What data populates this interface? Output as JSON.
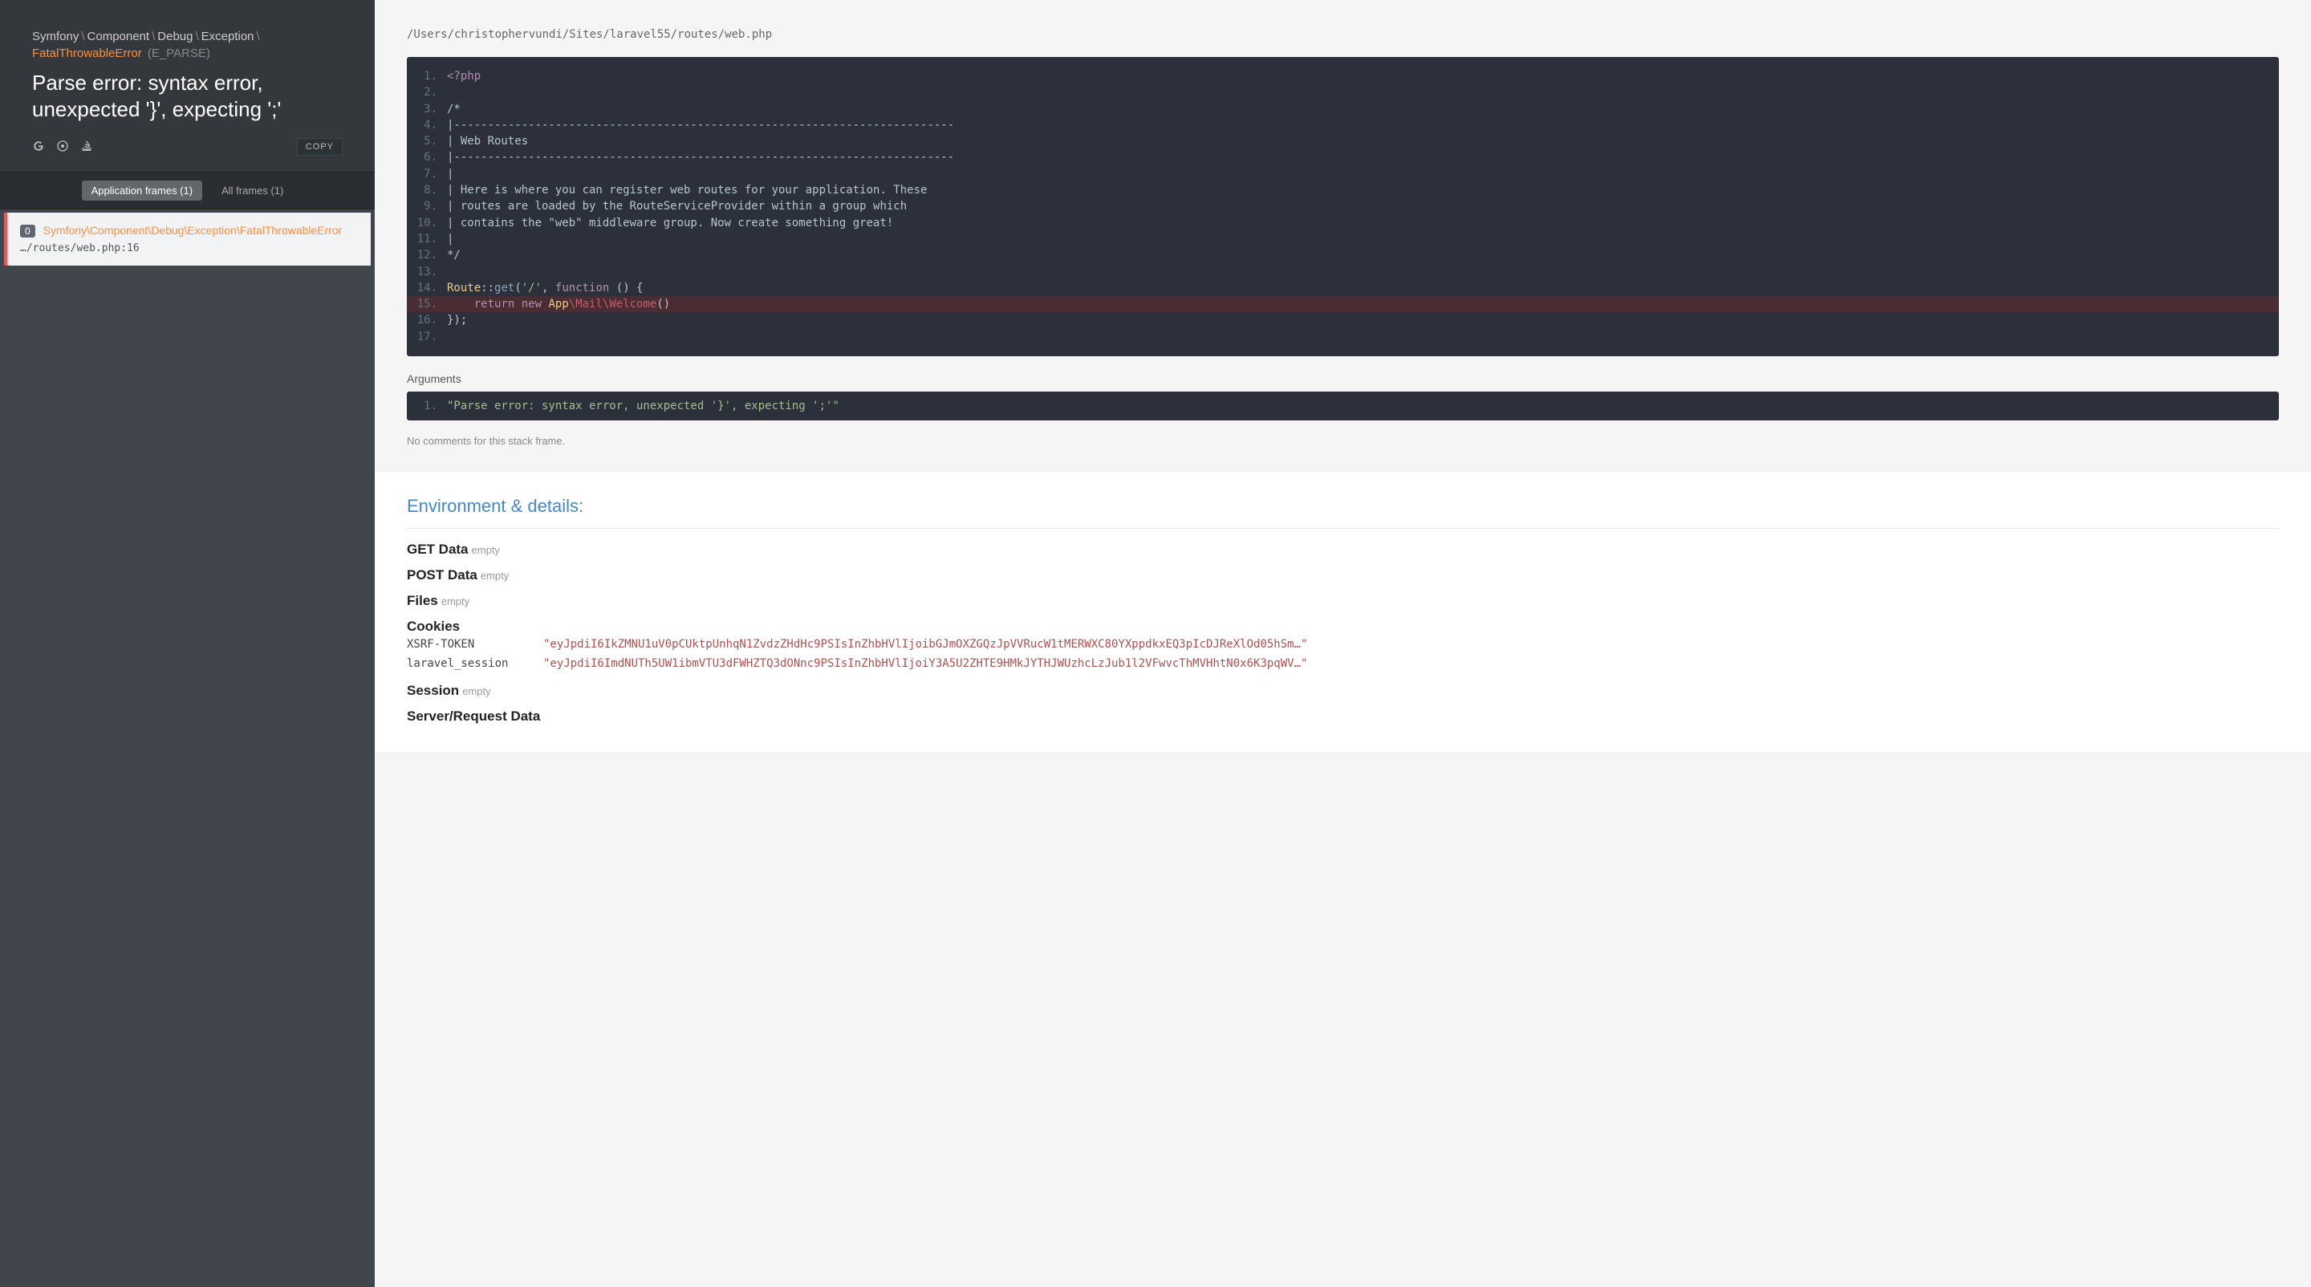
{
  "sidebar": {
    "exception_path": [
      "Symfony",
      "Component",
      "Debug",
      "Exception"
    ],
    "exception_class": "FatalThrowableError",
    "exception_type": "(E_PARSE)",
    "exception_message": "Parse error: syntax error, unexpected '}', expecting ';'",
    "copy_label": "COPY",
    "tabs": {
      "application": "Application frames (1)",
      "all": "All frames (1)"
    },
    "frame": {
      "index": "0",
      "class": "Symfony\\Component\\Debug\\Exception\\FatalThrowableError",
      "file": "…/routes/web.php:16"
    }
  },
  "main": {
    "file_path": "/Users/christophervundi/Sites/laravel55/routes/web.php",
    "code": {
      "start_line": 1,
      "highlight": 15,
      "lines": [
        [
          [
            "kw",
            "<?php"
          ]
        ],
        [],
        [
          [
            "cm",
            "/*"
          ]
        ],
        [
          [
            "cm",
            "|--------------------------------------------------------------------------"
          ]
        ],
        [
          [
            "cm",
            "| Web Routes"
          ]
        ],
        [
          [
            "cm",
            "|--------------------------------------------------------------------------"
          ]
        ],
        [
          [
            "cm",
            "|"
          ]
        ],
        [
          [
            "cm",
            "| Here is where you can register web routes for your application. These"
          ]
        ],
        [
          [
            "cm",
            "| routes are loaded by the RouteServiceProvider within a group which"
          ]
        ],
        [
          [
            "cm",
            "| contains the \"web\" middleware group. Now create something great!"
          ]
        ],
        [
          [
            "cm",
            "|"
          ]
        ],
        [
          [
            "cm",
            "*/"
          ]
        ],
        [],
        [
          [
            "cls",
            "Route"
          ],
          [
            "pn",
            "::"
          ],
          [
            "fn",
            "get"
          ],
          [
            "pn",
            "("
          ],
          [
            "str",
            "'/'"
          ],
          [
            "pn",
            ", "
          ],
          [
            "kw",
            "function"
          ],
          [
            "pn",
            " () {"
          ]
        ],
        [
          [
            "pn",
            "    "
          ],
          [
            "kw",
            "return"
          ],
          [
            "pn",
            " "
          ],
          [
            "kw",
            "new"
          ],
          [
            "pn",
            " "
          ],
          [
            "cls",
            "App"
          ],
          [
            "ns",
            "\\Mail\\Welcome"
          ],
          [
            "pn",
            "()"
          ]
        ],
        [
          [
            "pn",
            "});"
          ]
        ],
        []
      ]
    },
    "arguments_title": "Arguments",
    "arguments": [
      "\"Parse error: syntax error, unexpected '}', expecting ';'\""
    ],
    "no_comments": "No comments for this stack frame."
  },
  "env": {
    "title": "Environment & details:",
    "sections": [
      {
        "title": "GET Data",
        "empty": "empty"
      },
      {
        "title": "POST Data",
        "empty": "empty"
      },
      {
        "title": "Files",
        "empty": "empty"
      },
      {
        "title": "Cookies",
        "rows": [
          {
            "k": "XSRF-TOKEN",
            "v": "\"eyJpdiI6IkZMNU1uV0pCUktpUnhqN1ZvdzZHdHc9PSIsInZhbHVlIjoibGJmOXZGQzJpVVRucW1tMERWXC80YXppdkxEQ3pIcDJReXlOd05hSm…\""
          },
          {
            "k": "laravel_session",
            "v": "\"eyJpdiI6ImdNUTh5UW1ibmVTU3dFWHZTQ3dONnc9PSIsInZhbHVlIjoiY3A5U2ZHTE9HMkJYTHJWUzhcLzJub1l2VFwvcThMVHhtN0x6K3pqWV…\""
          }
        ]
      },
      {
        "title": "Session",
        "empty": "empty"
      },
      {
        "title": "Server/Request Data"
      }
    ]
  }
}
